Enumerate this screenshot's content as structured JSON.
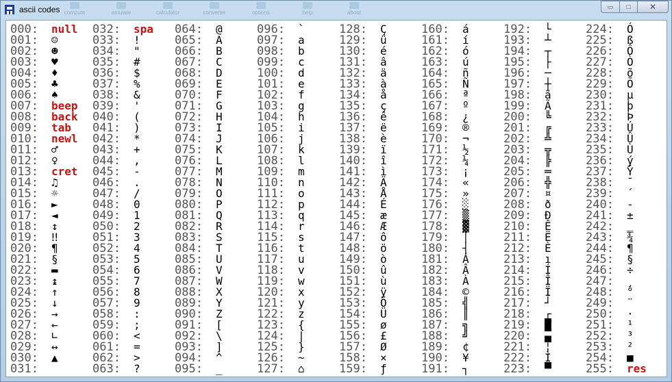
{
  "window": {
    "title": "ascii codes"
  },
  "toolbar_ghost": [
    "compute",
    "emulate",
    "calculator",
    "converter",
    "options",
    "help",
    "about"
  ],
  "controls": {
    "minimize": "▭",
    "maximize": "□",
    "close": "✕"
  },
  "columns": [
    {
      "rows": [
        {
          "num": "000:",
          "ch": "null",
          "ctl": true
        },
        {
          "num": "001:",
          "ch": "☺"
        },
        {
          "num": "002:",
          "ch": "☻"
        },
        {
          "num": "003:",
          "ch": "♥"
        },
        {
          "num": "004:",
          "ch": "♦"
        },
        {
          "num": "005:",
          "ch": "♣"
        },
        {
          "num": "006:",
          "ch": "♠"
        },
        {
          "num": "007:",
          "ch": "beep",
          "ctl": true
        },
        {
          "num": "008:",
          "ch": "back",
          "ctl": true
        },
        {
          "num": "009:",
          "ch": "tab",
          "ctl": true
        },
        {
          "num": "010:",
          "ch": "newl",
          "ctl": true
        },
        {
          "num": "011:",
          "ch": "♂"
        },
        {
          "num": "012:",
          "ch": "♀"
        },
        {
          "num": "013:",
          "ch": "cret",
          "ctl": true
        },
        {
          "num": "014:",
          "ch": "♫"
        },
        {
          "num": "015:",
          "ch": "☼"
        },
        {
          "num": "016:",
          "ch": "►"
        },
        {
          "num": "017:",
          "ch": "◄"
        },
        {
          "num": "018:",
          "ch": "↕"
        },
        {
          "num": "019:",
          "ch": "‼"
        },
        {
          "num": "020:",
          "ch": "¶"
        },
        {
          "num": "021:",
          "ch": "§"
        },
        {
          "num": "022:",
          "ch": "▬"
        },
        {
          "num": "023:",
          "ch": "↨"
        },
        {
          "num": "024:",
          "ch": "↑"
        },
        {
          "num": "025:",
          "ch": "↓"
        },
        {
          "num": "026:",
          "ch": "→"
        },
        {
          "num": "027:",
          "ch": "←"
        },
        {
          "num": "028:",
          "ch": "∟"
        },
        {
          "num": "029:",
          "ch": "↔"
        },
        {
          "num": "030:",
          "ch": "▲"
        },
        {
          "num": "031:",
          "ch": ""
        }
      ]
    },
    {
      "rows": [
        {
          "num": "032:",
          "ch": "spa",
          "ctl": true
        },
        {
          "num": "033:",
          "ch": "!"
        },
        {
          "num": "034:",
          "ch": "\""
        },
        {
          "num": "035:",
          "ch": "#"
        },
        {
          "num": "036:",
          "ch": "$"
        },
        {
          "num": "037:",
          "ch": "%"
        },
        {
          "num": "038:",
          "ch": "&"
        },
        {
          "num": "039:",
          "ch": "'"
        },
        {
          "num": "040:",
          "ch": "("
        },
        {
          "num": "041:",
          "ch": ")"
        },
        {
          "num": "042:",
          "ch": "*"
        },
        {
          "num": "043:",
          "ch": "+"
        },
        {
          "num": "044:",
          "ch": ","
        },
        {
          "num": "045:",
          "ch": "-"
        },
        {
          "num": "046:",
          "ch": "."
        },
        {
          "num": "047:",
          "ch": "/"
        },
        {
          "num": "048:",
          "ch": "0"
        },
        {
          "num": "049:",
          "ch": "1"
        },
        {
          "num": "050:",
          "ch": "2"
        },
        {
          "num": "051:",
          "ch": "3"
        },
        {
          "num": "052:",
          "ch": "4"
        },
        {
          "num": "053:",
          "ch": "5"
        },
        {
          "num": "054:",
          "ch": "6"
        },
        {
          "num": "055:",
          "ch": "7"
        },
        {
          "num": "056:",
          "ch": "8"
        },
        {
          "num": "057:",
          "ch": "9"
        },
        {
          "num": "058:",
          "ch": ":"
        },
        {
          "num": "059:",
          "ch": ";"
        },
        {
          "num": "060:",
          "ch": "<"
        },
        {
          "num": "061:",
          "ch": "="
        },
        {
          "num": "062:",
          "ch": ">"
        },
        {
          "num": "063:",
          "ch": "?"
        }
      ]
    },
    {
      "rows": [
        {
          "num": "064:",
          "ch": "@"
        },
        {
          "num": "065:",
          "ch": "A"
        },
        {
          "num": "066:",
          "ch": "B"
        },
        {
          "num": "067:",
          "ch": "C"
        },
        {
          "num": "068:",
          "ch": "D"
        },
        {
          "num": "069:",
          "ch": "E"
        },
        {
          "num": "070:",
          "ch": "F"
        },
        {
          "num": "071:",
          "ch": "G"
        },
        {
          "num": "072:",
          "ch": "H"
        },
        {
          "num": "073:",
          "ch": "I"
        },
        {
          "num": "074:",
          "ch": "J"
        },
        {
          "num": "075:",
          "ch": "K"
        },
        {
          "num": "076:",
          "ch": "L"
        },
        {
          "num": "077:",
          "ch": "M"
        },
        {
          "num": "078:",
          "ch": "N"
        },
        {
          "num": "079:",
          "ch": "O"
        },
        {
          "num": "080:",
          "ch": "P"
        },
        {
          "num": "081:",
          "ch": "Q"
        },
        {
          "num": "082:",
          "ch": "R"
        },
        {
          "num": "083:",
          "ch": "S"
        },
        {
          "num": "084:",
          "ch": "T"
        },
        {
          "num": "085:",
          "ch": "U"
        },
        {
          "num": "086:",
          "ch": "V"
        },
        {
          "num": "087:",
          "ch": "W"
        },
        {
          "num": "088:",
          "ch": "X"
        },
        {
          "num": "089:",
          "ch": "Y"
        },
        {
          "num": "090:",
          "ch": "Z"
        },
        {
          "num": "091:",
          "ch": "["
        },
        {
          "num": "092:",
          "ch": "\\"
        },
        {
          "num": "093:",
          "ch": "]"
        },
        {
          "num": "094:",
          "ch": "^"
        },
        {
          "num": "095:",
          "ch": "_"
        }
      ]
    },
    {
      "rows": [
        {
          "num": "096:",
          "ch": "`"
        },
        {
          "num": "097:",
          "ch": "a"
        },
        {
          "num": "098:",
          "ch": "b"
        },
        {
          "num": "099:",
          "ch": "c"
        },
        {
          "num": "100:",
          "ch": "d"
        },
        {
          "num": "101:",
          "ch": "e"
        },
        {
          "num": "102:",
          "ch": "f"
        },
        {
          "num": "103:",
          "ch": "g"
        },
        {
          "num": "104:",
          "ch": "h"
        },
        {
          "num": "105:",
          "ch": "i"
        },
        {
          "num": "106:",
          "ch": "j"
        },
        {
          "num": "107:",
          "ch": "k"
        },
        {
          "num": "108:",
          "ch": "l"
        },
        {
          "num": "109:",
          "ch": "m"
        },
        {
          "num": "110:",
          "ch": "n"
        },
        {
          "num": "111:",
          "ch": "o"
        },
        {
          "num": "112:",
          "ch": "p"
        },
        {
          "num": "113:",
          "ch": "q"
        },
        {
          "num": "114:",
          "ch": "r"
        },
        {
          "num": "115:",
          "ch": "s"
        },
        {
          "num": "116:",
          "ch": "t"
        },
        {
          "num": "117:",
          "ch": "u"
        },
        {
          "num": "118:",
          "ch": "v"
        },
        {
          "num": "119:",
          "ch": "w"
        },
        {
          "num": "120:",
          "ch": "x"
        },
        {
          "num": "121:",
          "ch": "y"
        },
        {
          "num": "122:",
          "ch": "z"
        },
        {
          "num": "123:",
          "ch": "{"
        },
        {
          "num": "124:",
          "ch": "|"
        },
        {
          "num": "125:",
          "ch": "}"
        },
        {
          "num": "126:",
          "ch": "~"
        },
        {
          "num": "127:",
          "ch": "⌂"
        }
      ]
    },
    {
      "rows": [
        {
          "num": "128:",
          "ch": "Ç"
        },
        {
          "num": "129:",
          "ch": "ü"
        },
        {
          "num": "130:",
          "ch": "é"
        },
        {
          "num": "131:",
          "ch": "â"
        },
        {
          "num": "132:",
          "ch": "ä"
        },
        {
          "num": "133:",
          "ch": "à"
        },
        {
          "num": "134:",
          "ch": "å"
        },
        {
          "num": "135:",
          "ch": "ç"
        },
        {
          "num": "136:",
          "ch": "ê"
        },
        {
          "num": "137:",
          "ch": "ë"
        },
        {
          "num": "138:",
          "ch": "è"
        },
        {
          "num": "139:",
          "ch": "ï"
        },
        {
          "num": "140:",
          "ch": "î"
        },
        {
          "num": "141:",
          "ch": "ì"
        },
        {
          "num": "142:",
          "ch": "Ä"
        },
        {
          "num": "143:",
          "ch": "Å"
        },
        {
          "num": "144:",
          "ch": "É"
        },
        {
          "num": "145:",
          "ch": "æ"
        },
        {
          "num": "146:",
          "ch": "Æ"
        },
        {
          "num": "147:",
          "ch": "ô"
        },
        {
          "num": "148:",
          "ch": "ö"
        },
        {
          "num": "149:",
          "ch": "ò"
        },
        {
          "num": "150:",
          "ch": "û"
        },
        {
          "num": "151:",
          "ch": "ù"
        },
        {
          "num": "152:",
          "ch": "ÿ"
        },
        {
          "num": "153:",
          "ch": "Ö"
        },
        {
          "num": "154:",
          "ch": "Ü"
        },
        {
          "num": "155:",
          "ch": "ø"
        },
        {
          "num": "156:",
          "ch": "£"
        },
        {
          "num": "157:",
          "ch": "Ø"
        },
        {
          "num": "158:",
          "ch": "×"
        },
        {
          "num": "159:",
          "ch": "ƒ"
        }
      ]
    },
    {
      "rows": [
        {
          "num": "160:",
          "ch": "á"
        },
        {
          "num": "161:",
          "ch": "í"
        },
        {
          "num": "162:",
          "ch": "ó"
        },
        {
          "num": "163:",
          "ch": "ú"
        },
        {
          "num": "164:",
          "ch": "ñ"
        },
        {
          "num": "165:",
          "ch": "Ñ"
        },
        {
          "num": "166:",
          "ch": "ª"
        },
        {
          "num": "167:",
          "ch": "º"
        },
        {
          "num": "168:",
          "ch": "¿"
        },
        {
          "num": "169:",
          "ch": "®"
        },
        {
          "num": "170:",
          "ch": "¬"
        },
        {
          "num": "171:",
          "ch": "½"
        },
        {
          "num": "172:",
          "ch": "¼"
        },
        {
          "num": "173:",
          "ch": "¡"
        },
        {
          "num": "174:",
          "ch": "«"
        },
        {
          "num": "175:",
          "ch": "»"
        },
        {
          "num": "176:",
          "ch": "░"
        },
        {
          "num": "177:",
          "ch": "▒"
        },
        {
          "num": "178:",
          "ch": "▓"
        },
        {
          "num": "179:",
          "ch": "│"
        },
        {
          "num": "180:",
          "ch": "┤"
        },
        {
          "num": "181:",
          "ch": "Á"
        },
        {
          "num": "182:",
          "ch": "Â"
        },
        {
          "num": "183:",
          "ch": "À"
        },
        {
          "num": "184:",
          "ch": "©"
        },
        {
          "num": "185:",
          "ch": "╣"
        },
        {
          "num": "186:",
          "ch": "║"
        },
        {
          "num": "187:",
          "ch": "╗"
        },
        {
          "num": "188:",
          "ch": "╝"
        },
        {
          "num": "189:",
          "ch": "¢"
        },
        {
          "num": "190:",
          "ch": "¥"
        },
        {
          "num": "191:",
          "ch": "┐"
        }
      ]
    },
    {
      "rows": [
        {
          "num": "192:",
          "ch": "└"
        },
        {
          "num": "193:",
          "ch": "┴"
        },
        {
          "num": "194:",
          "ch": "┬"
        },
        {
          "num": "195:",
          "ch": "├"
        },
        {
          "num": "196:",
          "ch": "─"
        },
        {
          "num": "197:",
          "ch": "┼"
        },
        {
          "num": "198:",
          "ch": "ã"
        },
        {
          "num": "199:",
          "ch": "Ã"
        },
        {
          "num": "200:",
          "ch": "╚"
        },
        {
          "num": "201:",
          "ch": "╔"
        },
        {
          "num": "202:",
          "ch": "╩"
        },
        {
          "num": "203:",
          "ch": "╦"
        },
        {
          "num": "204:",
          "ch": "╠"
        },
        {
          "num": "205:",
          "ch": "═"
        },
        {
          "num": "206:",
          "ch": "╬"
        },
        {
          "num": "207:",
          "ch": "¤"
        },
        {
          "num": "208:",
          "ch": "ð"
        },
        {
          "num": "209:",
          "ch": "Ð"
        },
        {
          "num": "210:",
          "ch": "Ê"
        },
        {
          "num": "211:",
          "ch": "Ë"
        },
        {
          "num": "212:",
          "ch": "È"
        },
        {
          "num": "213:",
          "ch": "ı"
        },
        {
          "num": "214:",
          "ch": "Í"
        },
        {
          "num": "215:",
          "ch": "Î"
        },
        {
          "num": "216:",
          "ch": "Ï"
        },
        {
          "num": "217:",
          "ch": "┘"
        },
        {
          "num": "218:",
          "ch": "┌"
        },
        {
          "num": "219:",
          "ch": "█"
        },
        {
          "num": "220:",
          "ch": "▄"
        },
        {
          "num": "221:",
          "ch": "¦"
        },
        {
          "num": "222:",
          "ch": "Ì"
        },
        {
          "num": "223:",
          "ch": "▀"
        }
      ]
    },
    {
      "rows": [
        {
          "num": "224:",
          "ch": "Ó"
        },
        {
          "num": "225:",
          "ch": "ß"
        },
        {
          "num": "226:",
          "ch": "Ô"
        },
        {
          "num": "227:",
          "ch": "Ò"
        },
        {
          "num": "228:",
          "ch": "õ"
        },
        {
          "num": "229:",
          "ch": "Õ"
        },
        {
          "num": "230:",
          "ch": "µ"
        },
        {
          "num": "231:",
          "ch": "þ"
        },
        {
          "num": "232:",
          "ch": "Þ"
        },
        {
          "num": "233:",
          "ch": "Ú"
        },
        {
          "num": "234:",
          "ch": "Û"
        },
        {
          "num": "235:",
          "ch": "Ù"
        },
        {
          "num": "236:",
          "ch": "ý"
        },
        {
          "num": "237:",
          "ch": "Ý"
        },
        {
          "num": "238:",
          "ch": "¯"
        },
        {
          "num": "239:",
          "ch": "´"
        },
        {
          "num": "240:",
          "ch": "-"
        },
        {
          "num": "241:",
          "ch": "±"
        },
        {
          "num": "242:",
          "ch": "‗"
        },
        {
          "num": "243:",
          "ch": "¾"
        },
        {
          "num": "244:",
          "ch": "¶"
        },
        {
          "num": "245:",
          "ch": "§"
        },
        {
          "num": "246:",
          "ch": "÷"
        },
        {
          "num": "247:",
          "ch": "¸"
        },
        {
          "num": "248:",
          "ch": "°"
        },
        {
          "num": "249:",
          "ch": "¨"
        },
        {
          "num": "250:",
          "ch": "·"
        },
        {
          "num": "251:",
          "ch": "¹"
        },
        {
          "num": "252:",
          "ch": "³"
        },
        {
          "num": "253:",
          "ch": "²"
        },
        {
          "num": "254:",
          "ch": "■"
        },
        {
          "num": "255:",
          "ch": "res",
          "ctl": true
        }
      ]
    }
  ]
}
